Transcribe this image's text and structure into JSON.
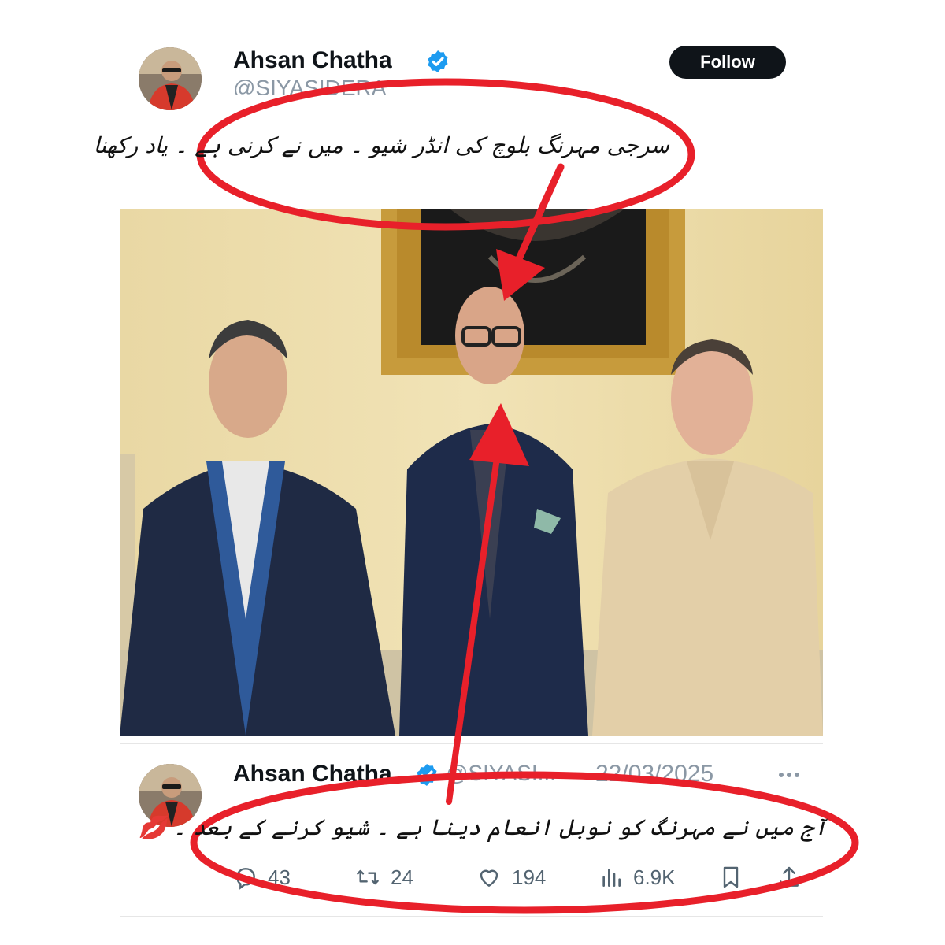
{
  "tweet_main": {
    "author_name": "Ahsan Chatha",
    "handle": "@SIYASIDERA",
    "follow_label": "Follow",
    "caption": "سرجی مہرنگ بلوچ کی انڈر شیو ۔ میں نے کرنی ہے ۔ یاد رکھنا"
  },
  "tweet_quoted": {
    "author_name": "Ahsan Chatha",
    "handle": "@SIYASI...",
    "separator": "·",
    "date": "22/03/2025",
    "text": "آج میں نے مہرنگ کو نوبل انعام دینا ہے ۔ شیو کرنے کے بعد ۔ 💋",
    "replies": "43",
    "retweets": "24",
    "likes": "194",
    "views": "6.9K"
  },
  "icons": {
    "verified": "verified-badge-icon",
    "more": "more-options-icon",
    "reply": "reply-icon",
    "retweet": "retweet-icon",
    "like": "heart-icon",
    "views": "views-icon",
    "bookmark": "bookmark-icon",
    "share": "share-icon"
  },
  "colors": {
    "annotation_red": "#e8202a",
    "verified_blue": "#1d9bf0",
    "follow_bg": "#0f1419",
    "muted_text": "#536471"
  }
}
